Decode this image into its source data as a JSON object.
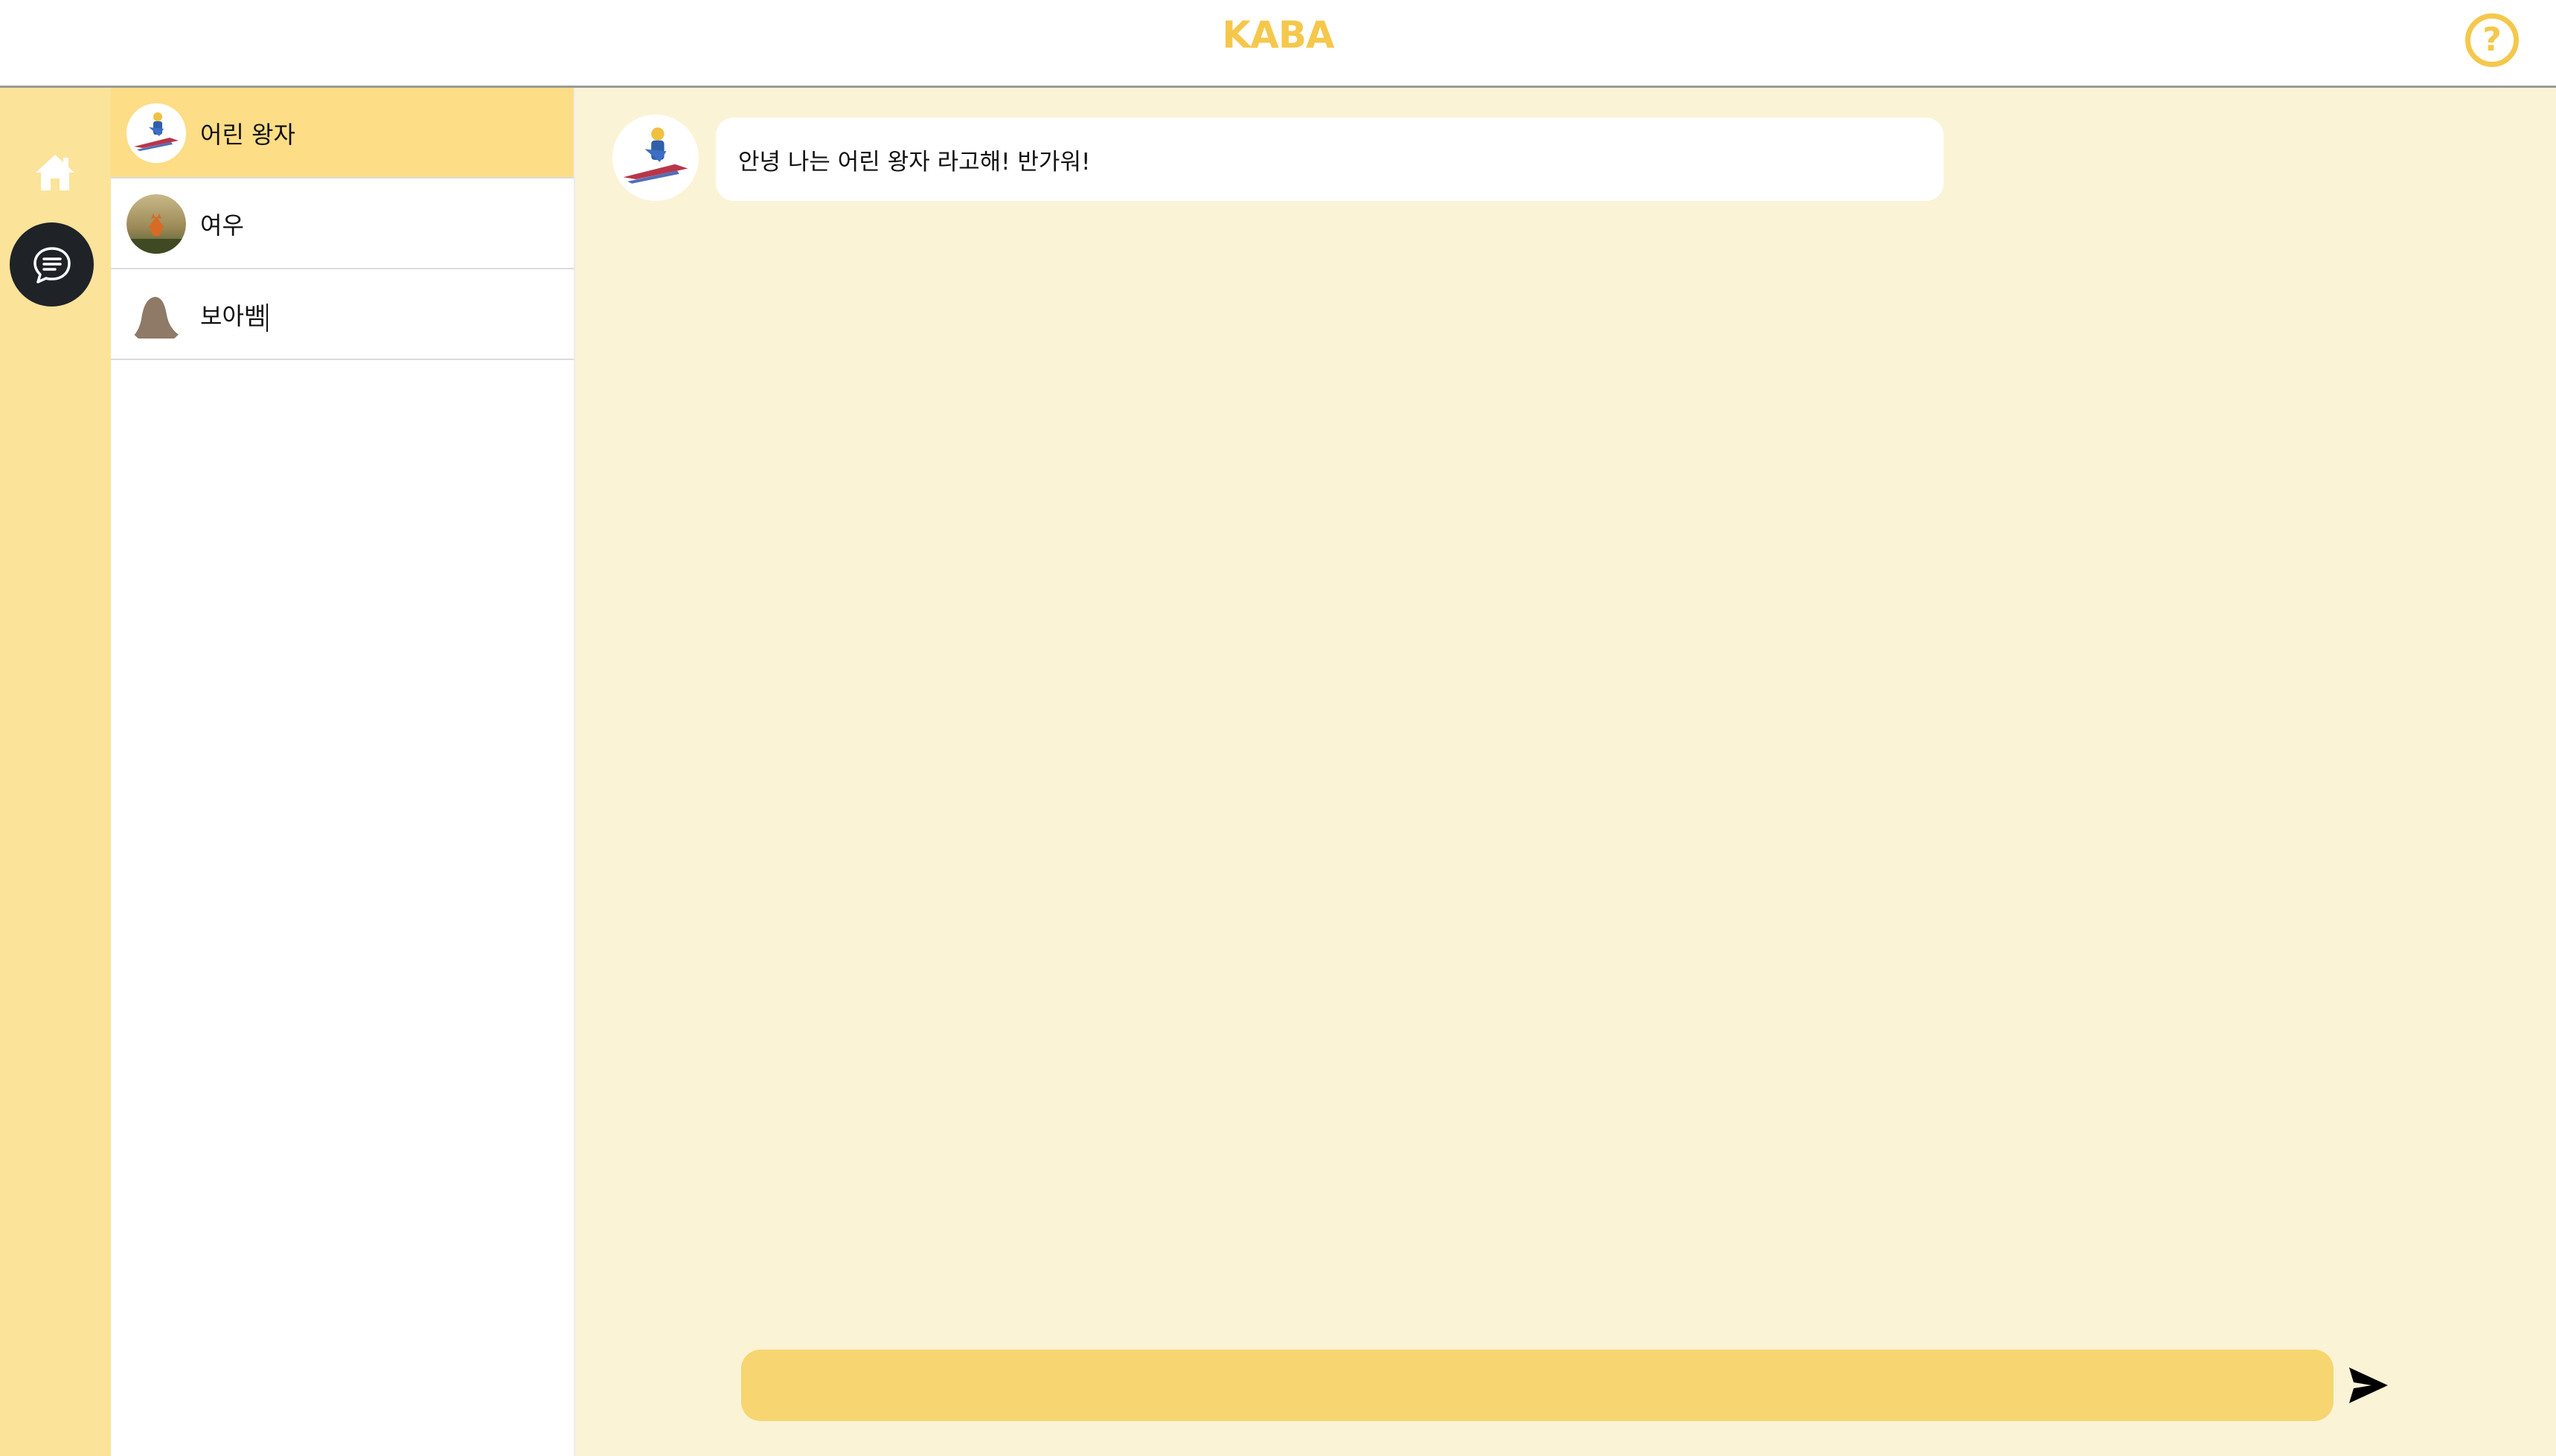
{
  "header": {
    "brand": "KABA",
    "help_icon": "question-circle-icon",
    "help_glyph": "?"
  },
  "rail": {
    "home_icon": "home-icon",
    "chat_icon": "chat-bubble-icon"
  },
  "characters": [
    {
      "name": "어린 왕자",
      "avatar": "little-prince-avatar",
      "active": true
    },
    {
      "name": "여우",
      "avatar": "fox-avatar",
      "active": false
    },
    {
      "name": "보아뱀",
      "avatar": "boa-snake-avatar",
      "active": false
    }
  ],
  "chat": {
    "messages": [
      {
        "sender": "어린 왕자",
        "text": "안녕 나는 어린 왕자 라고해! 반가워!"
      }
    ],
    "input_value": "",
    "send_icon": "send-arrow-icon"
  },
  "colors": {
    "accent": "#f5c84c",
    "rail_bg": "#fbe39a",
    "active_item": "#fddd86",
    "chat_bg": "#fbf3d6",
    "input_bg": "#f7d570",
    "rail_active_button": "#1f2328"
  }
}
